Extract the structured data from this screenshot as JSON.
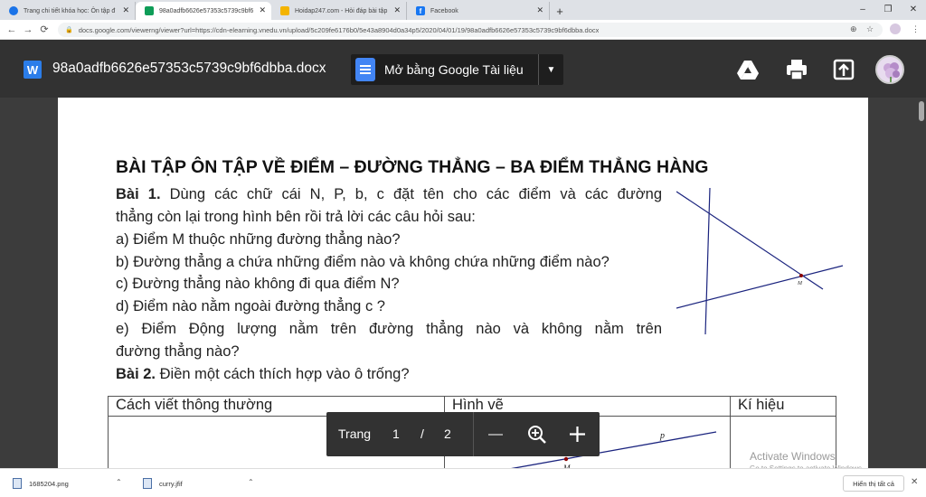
{
  "browser": {
    "tabs": [
      {
        "title": "Trang chi tiết khóa học: Ôn tập đ",
        "active": false,
        "favicon_color": "#1a73e8"
      },
      {
        "title": "98a0adfb6626e57353c5739c9bf6",
        "active": true,
        "favicon_color": "#0f9d58"
      },
      {
        "title": "Hoidap247.com - Hỏi đáp bài tập",
        "active": false,
        "favicon_color": "#f4b400"
      },
      {
        "title": "Facebook",
        "active": false,
        "favicon_color": "#1877f2"
      }
    ],
    "new_tab_label": "+",
    "url": "docs.google.com/viewerng/viewer?url=https://cdn-elearning.vnedu.vn/upload/5c209fe6176b0/5e43a8904d0a34p5/2020/04/01/19/98a0adfb6626e57353c5739c9bf6dbba.docx"
  },
  "viewer": {
    "file_icon_letter": "W",
    "filename": "98a0adfb6626e57353c5739c9bf6dbba.docx",
    "open_button_label": "Mở bằng Google Tài liệu",
    "icons": [
      "drive-icon",
      "print-icon",
      "open-in-new-icon"
    ]
  },
  "document": {
    "title": "BÀI TẬP ÔN TẬP VỀ ĐIỂM – ĐƯỜNG THẲNG – BA ĐIỂM THẲNG HÀNG",
    "bai1": {
      "label": "Bài 1.",
      "line1": "Dùng các chữ cái N, P, b, c đặt tên cho các điểm và các đường",
      "line2": "thẳng còn lại trong hình bên rồi trả lời các câu hỏi sau:",
      "a": "a)  Điểm M thuộc những đường thẳng nào?",
      "b": "b)  Đường thẳng a chứa những điểm nào và không chứa những điểm nào?",
      "c": "c)  Đường thẳng nào không đi qua điểm N?",
      "d": "d)  Điểm nào nằm ngoài đường thẳng c ?",
      "e1": "e)  Điểm Động lượng nằm trên đường thẳng nào và không nằm trên",
      "e2": "đường thẳng nào?"
    },
    "bai2": {
      "label": "Bài 2.",
      "text": "Điền một cách thích hợp vào ô trống?"
    },
    "figure_label_M": "M",
    "table": {
      "headers": [
        "Cách viết thông thường",
        "Hình vẽ",
        "Kí hiệu"
      ],
      "fig_label_p": "p",
      "fig_label_M": "M"
    }
  },
  "page_control": {
    "label": "Trang",
    "current": "1",
    "separator": "/",
    "total": "2"
  },
  "watermark": {
    "title": "Activate Windows",
    "subtitle": "Go to Settings to activate Windows."
  },
  "downloads": {
    "items": [
      "1685204.png",
      "curry.jfif"
    ],
    "show_all_label": "Hiển thị tất cả",
    "close_label": "✕"
  }
}
